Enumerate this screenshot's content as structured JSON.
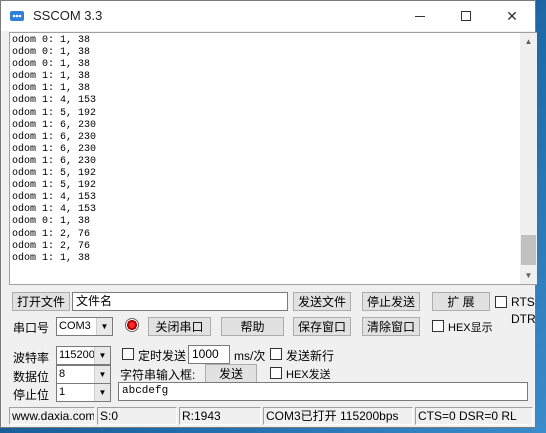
{
  "window": {
    "title": "SSCOM 3.3"
  },
  "receive_lines": [
    "odom 0: 1, 38",
    "odom 0: 1, 38",
    "odom 0: 1, 38",
    "odom 1: 1, 38",
    "odom 1: 1, 38",
    "odom 1: 4, 153",
    "odom 1: 5, 192",
    "odom 1: 6, 230",
    "odom 1: 6, 230",
    "odom 1: 6, 230",
    "odom 1: 6, 230",
    "odom 1: 5, 192",
    "odom 1: 5, 192",
    "odom 1: 4, 153",
    "odom 1: 4, 153",
    "odom 0: 1, 38",
    "odom 1: 2, 76",
    "odom 1: 2, 76",
    "odom 1: 1, 38"
  ],
  "file_row": {
    "open_file": "打开文件",
    "file_name": "文件名",
    "send_file": "发送文件",
    "stop_send": "停止发送",
    "expand": "扩 展",
    "rts": "RTS",
    "dtr": "DTR"
  },
  "port_row": {
    "port_label": "串口号",
    "port_value": "COM3",
    "close_port": "关闭串口",
    "help": "帮助",
    "save_window": "保存窗口",
    "clear_window": "清除窗口",
    "hex_display": "HEX显示"
  },
  "settings": {
    "baud_label": "波特率",
    "baud_value": "115200",
    "data_bits_label": "数据位",
    "data_bits_value": "8",
    "stop_bits_label": "停止位",
    "stop_bits_value": "1",
    "timed_send": "定时发送",
    "interval_value": "1000",
    "interval_unit": "ms/次",
    "send_newline": "发送新行",
    "string_input_label": "字符串输入框:",
    "send_button": "发送",
    "hex_send": "HEX发送",
    "input_value": "abcdefg"
  },
  "status": {
    "website": "www.daxia.com",
    "sent": "S:0",
    "received": "R:1943",
    "port_state": "COM3已打开  115200bps",
    "signals": "CTS=0 DSR=0 RL"
  }
}
